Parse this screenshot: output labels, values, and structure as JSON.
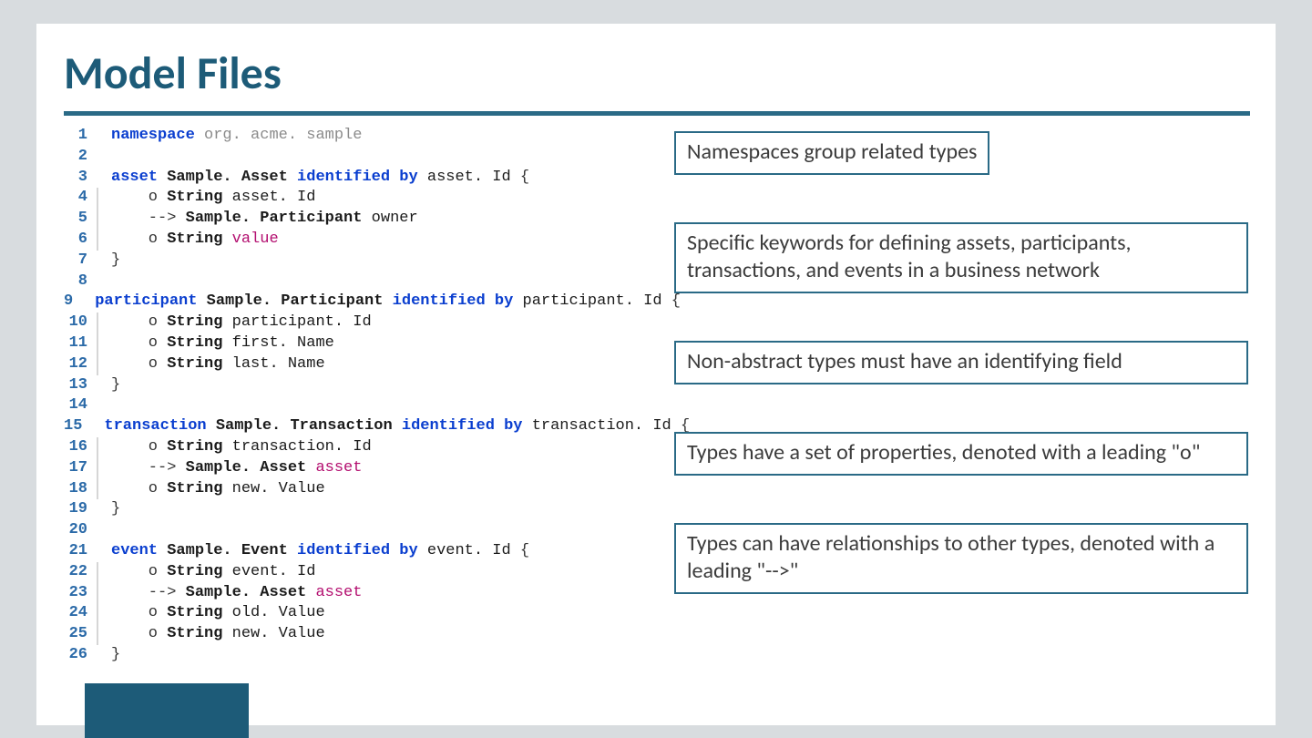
{
  "title": "Model Files",
  "code": {
    "lines": [
      {
        "n": 1,
        "bar": false,
        "tokens": [
          {
            "t": "namespace ",
            "c": "kw"
          },
          {
            "t": "org. acme. sample",
            "c": "ns"
          }
        ]
      },
      {
        "n": 2,
        "bar": false,
        "tokens": []
      },
      {
        "n": 3,
        "bar": false,
        "tokens": [
          {
            "t": "asset ",
            "c": "kw"
          },
          {
            "t": "Sample. Asset ",
            "c": "typ"
          },
          {
            "t": "identified by ",
            "c": "kw"
          },
          {
            "t": "asset. Id ",
            "c": "ident"
          },
          {
            "t": "{",
            "c": "pct"
          }
        ]
      },
      {
        "n": 4,
        "bar": true,
        "tokens": [
          {
            "t": "    o ",
            "c": "pct"
          },
          {
            "t": "String ",
            "c": "typ"
          },
          {
            "t": "asset. Id",
            "c": "ident"
          }
        ]
      },
      {
        "n": 5,
        "bar": true,
        "tokens": [
          {
            "t": "    --> ",
            "c": "pct"
          },
          {
            "t": "Sample. Participant ",
            "c": "typ"
          },
          {
            "t": "owner",
            "c": "ident"
          }
        ]
      },
      {
        "n": 6,
        "bar": true,
        "tokens": [
          {
            "t": "    o ",
            "c": "pct"
          },
          {
            "t": "String ",
            "c": "typ"
          },
          {
            "t": "value",
            "c": "fld"
          }
        ]
      },
      {
        "n": 7,
        "bar": false,
        "tokens": [
          {
            "t": "}",
            "c": "pct"
          }
        ]
      },
      {
        "n": 8,
        "bar": false,
        "tokens": []
      },
      {
        "n": 9,
        "bar": false,
        "tokens": [
          {
            "t": "participant ",
            "c": "kw"
          },
          {
            "t": "Sample. Participant ",
            "c": "typ"
          },
          {
            "t": "identified by ",
            "c": "kw"
          },
          {
            "t": "participant. Id ",
            "c": "ident"
          },
          {
            "t": "{",
            "c": "pct"
          }
        ]
      },
      {
        "n": 10,
        "bar": true,
        "tokens": [
          {
            "t": "    o ",
            "c": "pct"
          },
          {
            "t": "String ",
            "c": "typ"
          },
          {
            "t": "participant. Id",
            "c": "ident"
          }
        ]
      },
      {
        "n": 11,
        "bar": true,
        "tokens": [
          {
            "t": "    o ",
            "c": "pct"
          },
          {
            "t": "String ",
            "c": "typ"
          },
          {
            "t": "first. Name",
            "c": "ident"
          }
        ]
      },
      {
        "n": 12,
        "bar": true,
        "tokens": [
          {
            "t": "    o ",
            "c": "pct"
          },
          {
            "t": "String ",
            "c": "typ"
          },
          {
            "t": "last. Name",
            "c": "ident"
          }
        ]
      },
      {
        "n": 13,
        "bar": false,
        "tokens": [
          {
            "t": "}",
            "c": "pct"
          }
        ]
      },
      {
        "n": 14,
        "bar": false,
        "tokens": []
      },
      {
        "n": 15,
        "bar": false,
        "tokens": [
          {
            "t": "transaction ",
            "c": "kw"
          },
          {
            "t": "Sample. Transaction ",
            "c": "typ"
          },
          {
            "t": "identified by ",
            "c": "kw"
          },
          {
            "t": "transaction. Id ",
            "c": "ident"
          },
          {
            "t": "{",
            "c": "pct"
          }
        ]
      },
      {
        "n": 16,
        "bar": true,
        "tokens": [
          {
            "t": "    o ",
            "c": "pct"
          },
          {
            "t": "String ",
            "c": "typ"
          },
          {
            "t": "transaction. Id",
            "c": "ident"
          }
        ]
      },
      {
        "n": 17,
        "bar": true,
        "tokens": [
          {
            "t": "    --> ",
            "c": "pct"
          },
          {
            "t": "Sample. Asset ",
            "c": "typ"
          },
          {
            "t": "asset",
            "c": "fld"
          }
        ]
      },
      {
        "n": 18,
        "bar": true,
        "tokens": [
          {
            "t": "    o ",
            "c": "pct"
          },
          {
            "t": "String ",
            "c": "typ"
          },
          {
            "t": "new. Value",
            "c": "ident"
          }
        ]
      },
      {
        "n": 19,
        "bar": false,
        "tokens": [
          {
            "t": "}",
            "c": "pct"
          }
        ]
      },
      {
        "n": 20,
        "bar": false,
        "tokens": []
      },
      {
        "n": 21,
        "bar": false,
        "tokens": [
          {
            "t": "event ",
            "c": "kw"
          },
          {
            "t": "Sample. Event ",
            "c": "typ"
          },
          {
            "t": "identified by ",
            "c": "kw"
          },
          {
            "t": "event. Id ",
            "c": "ident"
          },
          {
            "t": "{",
            "c": "pct"
          }
        ]
      },
      {
        "n": 22,
        "bar": true,
        "tokens": [
          {
            "t": "    o ",
            "c": "pct"
          },
          {
            "t": "String ",
            "c": "typ"
          },
          {
            "t": "event. Id",
            "c": "ident"
          }
        ]
      },
      {
        "n": 23,
        "bar": true,
        "tokens": [
          {
            "t": "    --> ",
            "c": "pct"
          },
          {
            "t": "Sample. Asset ",
            "c": "typ"
          },
          {
            "t": "asset",
            "c": "fld"
          }
        ]
      },
      {
        "n": 24,
        "bar": true,
        "tokens": [
          {
            "t": "    o ",
            "c": "pct"
          },
          {
            "t": "String ",
            "c": "typ"
          },
          {
            "t": "old. Value",
            "c": "ident"
          }
        ]
      },
      {
        "n": 25,
        "bar": true,
        "tokens": [
          {
            "t": "    o ",
            "c": "pct"
          },
          {
            "t": "String ",
            "c": "typ"
          },
          {
            "t": "new. Value",
            "c": "ident"
          }
        ]
      },
      {
        "n": 26,
        "bar": false,
        "tokens": [
          {
            "t": "}",
            "c": "pct"
          }
        ]
      }
    ]
  },
  "callouts": [
    {
      "text": "Namespaces group related types",
      "narrow": true
    },
    {
      "text": "Specific keywords for defining assets, participants, transactions, and events in a business network",
      "narrow": false
    },
    {
      "text": "Non-abstract types must have an identifying field",
      "narrow": false
    },
    {
      "text": "Types have a set of properties, denoted with a leading \"o\"",
      "narrow": false
    },
    {
      "text": "Types can have relationships to other types, denoted with a leading \"-->\"",
      "narrow": false
    }
  ]
}
